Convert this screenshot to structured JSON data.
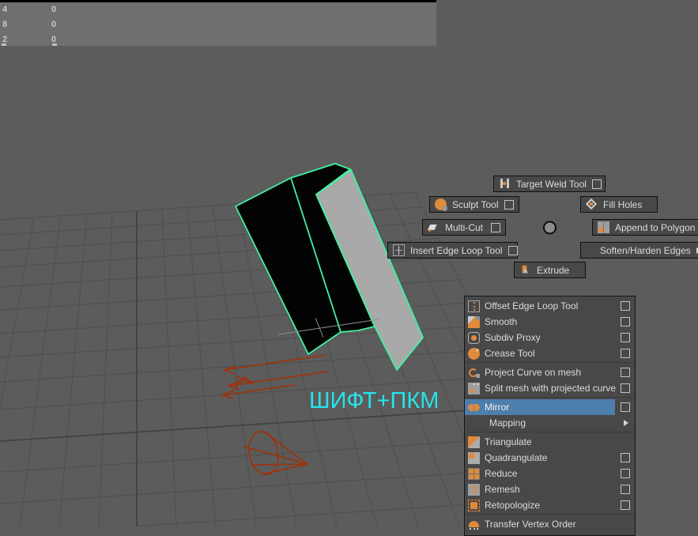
{
  "hud": {
    "rows": [
      {
        "left": "4",
        "right": "0"
      },
      {
        "left": "8",
        "right": "0"
      },
      {
        "left": "2",
        "right": "0"
      }
    ]
  },
  "viewport": {
    "overlay_text": "ШИФТ+ПКМ"
  },
  "marking_menu": {
    "buttons": [
      {
        "label": "Target Weld Tool",
        "icon": "target-weld-icon",
        "option_box": true
      },
      {
        "label": "Sculpt Tool",
        "icon": "sculpt-icon",
        "option_box": true
      },
      {
        "label": "Fill Holes",
        "icon": "fill-holes-icon",
        "option_box": false
      },
      {
        "label": "Multi-Cut",
        "icon": "multi-cut-icon",
        "option_box": true
      },
      {
        "label": "Append to Polygon T",
        "icon": "append-to-polygon-icon",
        "option_box": false,
        "clipped_by_screen_edge": true
      },
      {
        "label": "Insert Edge Loop Tool",
        "icon": "insert-edge-loop-icon",
        "option_box": true
      },
      {
        "label": "Soften/Harden Edges",
        "icon": null,
        "submenu": true
      },
      {
        "label": "Extrude",
        "icon": "extrude-icon",
        "option_box": false
      }
    ]
  },
  "context_menu": {
    "items": [
      {
        "label": "Offset Edge Loop Tool",
        "icon": "offset-edge-loop-icon",
        "option_box": true
      },
      {
        "label": "Smooth",
        "icon": "smooth-icon",
        "option_box": true
      },
      {
        "label": "Subdiv Proxy",
        "icon": "subdiv-proxy-icon",
        "option_box": true
      },
      {
        "label": "Crease Tool",
        "icon": "crease-tool-icon",
        "option_box": true,
        "separator_after": true
      },
      {
        "label": "Project Curve on mesh",
        "icon": "project-curve-icon",
        "option_box": true
      },
      {
        "label": "Split mesh with projected curve",
        "icon": "split-mesh-icon",
        "option_box": true,
        "separator_after": true
      },
      {
        "label": "Mirror",
        "icon": "mirror-icon",
        "option_box": true,
        "highlighted": true
      },
      {
        "label": "Mapping",
        "icon": null,
        "submenu": true,
        "separator_after": true
      },
      {
        "label": "Triangulate",
        "icon": "triangulate-icon",
        "option_box": false
      },
      {
        "label": "Quadrangulate",
        "icon": "quadrangulate-icon",
        "option_box": true
      },
      {
        "label": "Reduce",
        "icon": "reduce-icon",
        "option_box": true
      },
      {
        "label": "Remesh",
        "icon": "remesh-icon",
        "option_box": true
      },
      {
        "label": "Retopologize",
        "icon": "retopologize-icon",
        "option_box": true,
        "separator_after": true
      },
      {
        "label": "Transfer Vertex Order",
        "icon": "transfer-vertex-order-icon",
        "clipped_by_screen_edge": true
      }
    ]
  },
  "colors": {
    "viewport_bg": "#5C5C5C",
    "hud_bg": "#6F6F6F",
    "panel_bg": "#484848",
    "grid_line": "#4E4E4E",
    "grid_axis": "#424242",
    "selection_green": "#3FF3A0",
    "face_black": "#030303",
    "face_gray": "#A9A9A9",
    "curve_red": "#A23007",
    "highlight_blue": "#4E7EAC",
    "icon_orange": "#E08A3C",
    "overlay_cyan": "#27E3E9",
    "text_light": "#DCDCDC",
    "center_knob": "#8C8C8C",
    "overdraw_gray": "#8F8F8F"
  }
}
